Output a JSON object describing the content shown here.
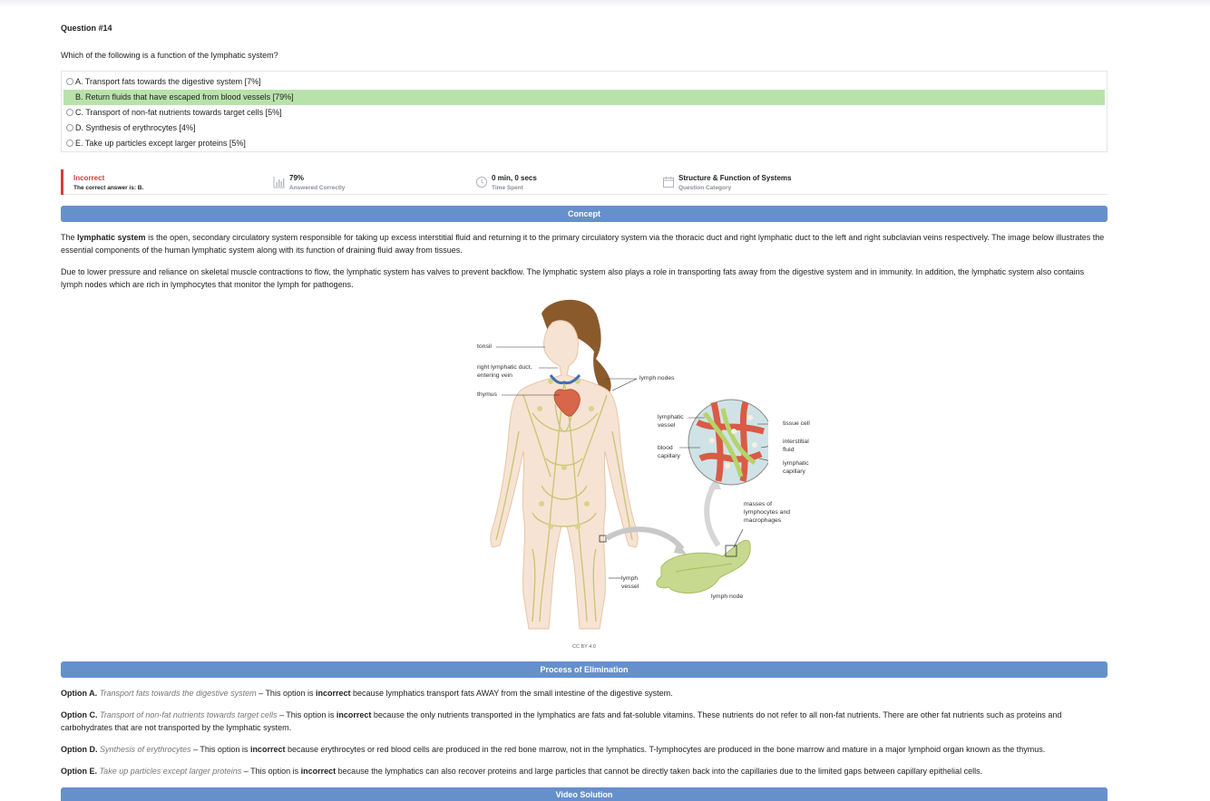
{
  "question": {
    "number": "Question #14",
    "text": "Which of the following is a function of the lymphatic system?"
  },
  "options": [
    {
      "label": "A. Transport fats towards the digestive system [7%]",
      "correct": false
    },
    {
      "label": "B. Return fluids that have escaped from blood vessels [79%]",
      "correct": true
    },
    {
      "label": "C. Transport of non-fat nutrients towards target cells [5%]",
      "correct": false
    },
    {
      "label": "D. Synthesis of erythrocytes [4%]",
      "correct": false
    },
    {
      "label": "E. Take up particles except larger proteins [5%]",
      "correct": false
    }
  ],
  "result": {
    "status": "Incorrect",
    "correct_answer": "The correct answer is: B.",
    "percent": "79%",
    "percent_label": "Answered Correctly",
    "time": "0 min, 0 secs",
    "time_label": "Time Spent",
    "category": "Structure & Function of Systems",
    "category_label": "Question Category"
  },
  "sections": {
    "concept": "Concept",
    "elimination": "Process of Elimination",
    "video": "Video Solution"
  },
  "concept": {
    "p1_pre": "The ",
    "p1_bold": "lymphatic system",
    "p1_post": " is the open, secondary circulatory system responsible for taking up excess interstitial fluid and returning it to the primary circulatory system via the thoracic duct and right lymphatic duct to the left and right subclavian veins respectively. The image below illustrates the essential components of the human lymphatic system along with its function of draining fluid away from tissues.",
    "p2": "Due to lower pressure and reliance on skeletal muscle contractions to flow, the lymphatic system has valves to prevent backflow. The lymphatic system also plays a role in transporting fats away from the digestive system and in immunity. In addition, the lymphatic system also contains lymph nodes which are rich in lymphocytes that monitor the lymph for pathogens."
  },
  "figure": {
    "labels": {
      "tonsil": "tonsil",
      "duct1": "right lymphatic duct,",
      "duct2": "entering vein",
      "thymus": "thymus",
      "nodes": "lymph nodes",
      "lv1": "lymphatic",
      "lv2": "vessel",
      "bc1": "blood",
      "bc2": "capillary",
      "tissue": "tissue cell",
      "if1": "interstitial",
      "if2": "fluid",
      "lc1": "lymphatic",
      "lc2": "capillary",
      "m1": "masses of",
      "m2": "lymphocytes and",
      "m3": "macrophages",
      "lvv1": "lymph",
      "lvv2": "vessel",
      "node": "lymph node"
    },
    "credit": "CC BY 4.0"
  },
  "elimination": [
    {
      "opt": "Option A.",
      "quote": "Transport fats towards the digestive system",
      "mid": " – This option is ",
      "bold": "incorrect",
      "rest": " because lymphatics transport fats AWAY from the small intestine of the digestive system."
    },
    {
      "opt": "Option C.",
      "quote": "Transport of non-fat nutrients towards target cells",
      "mid": " – This option is ",
      "bold": "incorrect",
      "rest": " because the only nutrients transported in the lymphatics are fats and fat-soluble vitamins. These nutrients do not refer to all non-fat nutrients. There are other fat nutrients such as proteins and carbohydrates that are not transported by the lymphatic system."
    },
    {
      "opt": "Option D.",
      "quote": "Synthesis of erythrocytes",
      "mid": " – This option is ",
      "bold": "incorrect",
      "rest": " because erythrocytes or red blood cells are produced in the red bone marrow, not in the lymphatics. T-lymphocytes are produced in the bone marrow and mature in a major lymphoid organ known as the thymus."
    },
    {
      "opt": "Option E.",
      "quote": "Take up particles except larger proteins",
      "mid": " – This option is ",
      "bold": "incorrect",
      "rest": " because the lymphatics can also recover proteins and large particles that cannot be directly taken back into the capillaries due to the limited gaps between capillary epithelial cells."
    }
  ],
  "colors": {
    "accent": "#6690cc",
    "correct": "#b9e2ab",
    "incorrect": "#d33d3d"
  }
}
